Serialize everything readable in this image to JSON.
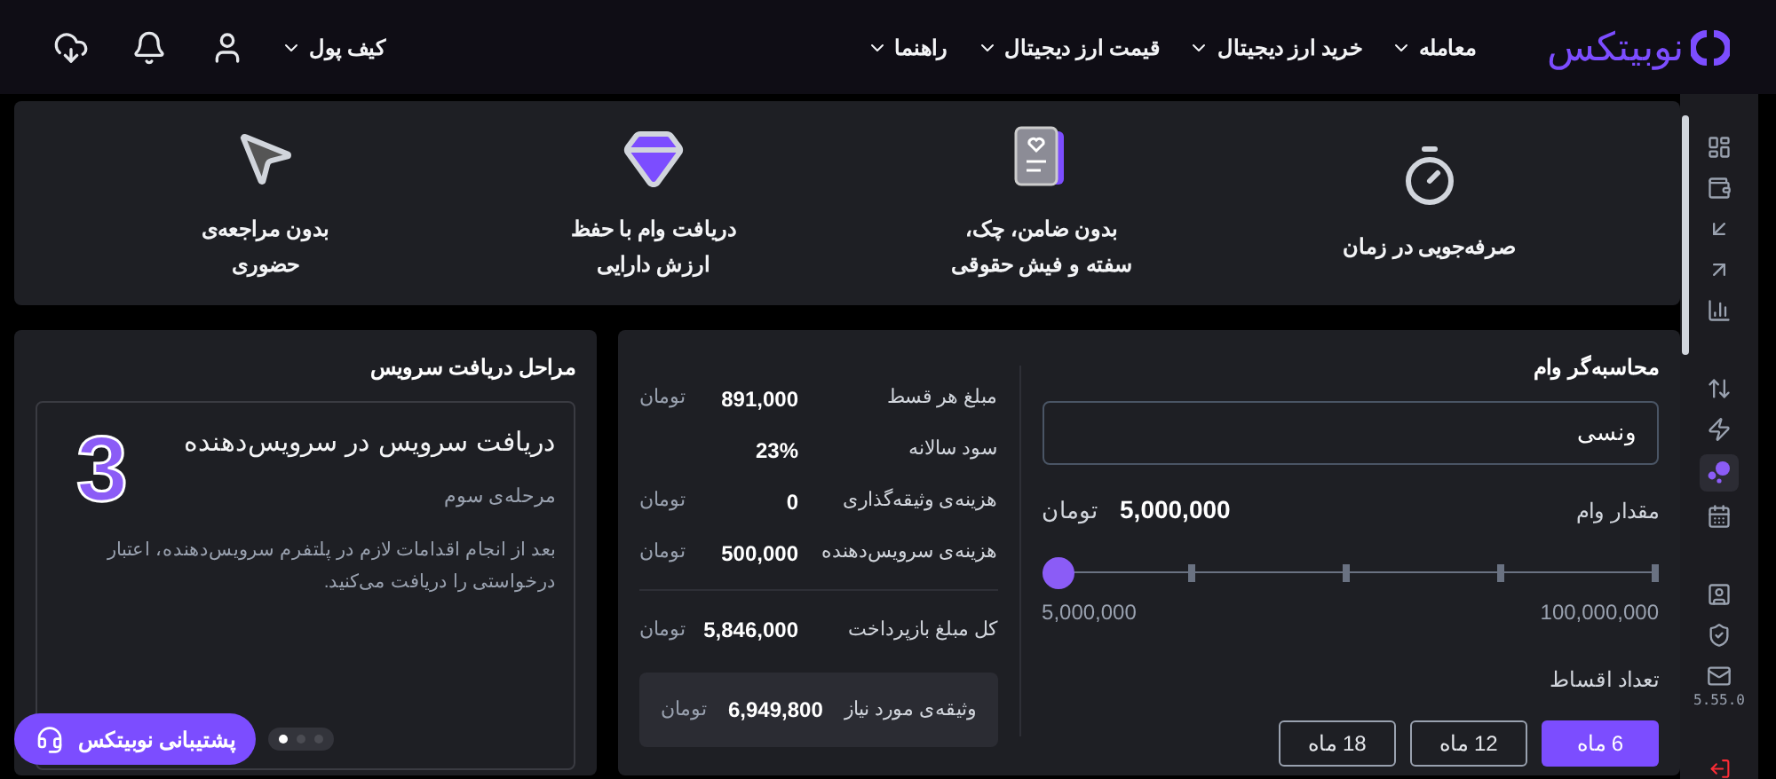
{
  "header": {
    "logo": "نوبیتکس",
    "nav": [
      {
        "label": "معامله"
      },
      {
        "label": "خرید ارز دیجیتال"
      },
      {
        "label": "قیمت ارز دیجیتال"
      },
      {
        "label": "راهنما"
      }
    ],
    "wallet": "کیف پول"
  },
  "features": [
    {
      "kind": "stopwatch",
      "text": "صرفه‌جویی در زمان"
    },
    {
      "kind": "document",
      "text": "بدون ضامن، چک،\nسفته و فیش حقوقی"
    },
    {
      "kind": "gem",
      "text": "دریافت وام با حفظ\nارزش دارایی"
    },
    {
      "kind": "cursor",
      "text": "بدون مراجعه‌ی\nحضوری"
    }
  ],
  "calculator": {
    "title": "محاسبه‌گر وام",
    "provider": "ونسی",
    "amount_label": "مقدار وام",
    "amount": "5,000,000",
    "amount_unit": "تومان",
    "slider": {
      "level": 0,
      "min": "5,000,000",
      "max": "100,000,000"
    },
    "installments_label": "تعداد اقساط",
    "options": [
      {
        "label": "6 ماه",
        "selected": true
      },
      {
        "label": "12 ماه",
        "selected": false
      },
      {
        "label": "18 ماه",
        "selected": false
      }
    ],
    "results": [
      {
        "label": "مبلغ هر قسط",
        "value": "891,000",
        "unit": "تومان"
      },
      {
        "label": "سود سالانه",
        "value": "23%"
      },
      {
        "label": "هزینه‌ی وثیقه‌گذاری",
        "value": "0",
        "unit": "تومان"
      },
      {
        "label": "هزینه‌ی سرویس‌دهنده",
        "value": "500,000",
        "unit": "تومان"
      }
    ],
    "total": {
      "label": "کل مبلغ بازپرداخت",
      "value": "5,846,000",
      "unit": "تومان"
    },
    "collateral": {
      "label": "وثیقه‌ی مورد نیاز",
      "value": "6,949,800",
      "unit": "تومان"
    }
  },
  "steps": {
    "title": "مراحل دریافت سرویس",
    "card": {
      "number": "3",
      "title": "دریافت سرویس در سرویس‌دهنده",
      "subtitle": "مرحله‌ی سوم",
      "body": "بعد از انجام اقدامات لازم در پلتفرم سرویس‌دهنده، اعتبار درخواستی را دریافت می‌کنید."
    },
    "dots": [
      {
        "selected": true
      },
      {
        "selected": false
      },
      {
        "selected": false
      }
    ]
  },
  "support": "پشتیبانی نوبیتکس",
  "sidebar": {
    "items": [
      {
        "kind": "dashboard",
        "selected": false
      },
      {
        "kind": "wallet",
        "selected": false
      },
      {
        "kind": "deposit",
        "selected": false
      },
      {
        "kind": "withdraw",
        "selected": false
      },
      {
        "kind": "chart",
        "selected": false
      },
      {
        "kind": "gap"
      },
      {
        "kind": "exchange",
        "selected": false
      },
      {
        "kind": "bolt",
        "selected": false
      },
      {
        "kind": "loan",
        "selected": true
      },
      {
        "kind": "calendar",
        "selected": false
      },
      {
        "kind": "gap"
      },
      {
        "kind": "profile",
        "selected": false
      },
      {
        "kind": "shield",
        "selected": false
      },
      {
        "kind": "mail",
        "selected": false
      }
    ],
    "version": "5.55.0"
  }
}
